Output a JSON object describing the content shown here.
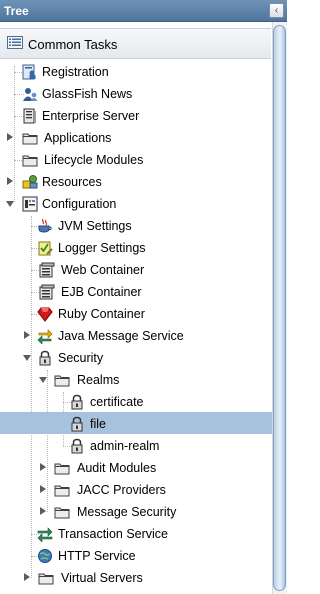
{
  "header": {
    "title": "Tree"
  },
  "common_tasks": {
    "label": "Common Tasks"
  },
  "tree": {
    "registration": "Registration",
    "glassfish_news": "GlassFish News",
    "enterprise_server": "Enterprise Server",
    "applications": "Applications",
    "lifecycle_modules": "Lifecycle Modules",
    "resources": "Resources",
    "configuration": "Configuration",
    "jvm_settings": "JVM Settings",
    "logger_settings": "Logger Settings",
    "web_container": "Web Container",
    "ejb_container": "EJB Container",
    "ruby_container": "Ruby Container",
    "java_message_service": "Java Message Service",
    "security": "Security",
    "realms": "Realms",
    "certificate": "certificate",
    "file": "file",
    "admin_realm": "admin-realm",
    "audit_modules": "Audit Modules",
    "jacc_providers": "JACC Providers",
    "message_security": "Message Security",
    "transaction_service": "Transaction Service",
    "http_service": "HTTP Service",
    "virtual_servers": "Virtual Servers"
  },
  "icons": {
    "registration": "registration-icon",
    "glassfish_news": "glassfish-news-icon",
    "enterprise_server": "server-icon",
    "folder": "folder-icon",
    "resources": "resources-icon",
    "configuration": "configuration-icon",
    "jvm_settings": "java-cup-icon",
    "logger_settings": "logger-icon",
    "container": "container-icon",
    "ruby": "ruby-gem-icon",
    "jms": "exchange-arrows-icon",
    "lock": "lock-icon",
    "transaction": "transaction-arrows-icon",
    "http": "globe-icon"
  },
  "colors": {
    "header": "#5b7fa6",
    "selection": "#a7c2dd"
  }
}
